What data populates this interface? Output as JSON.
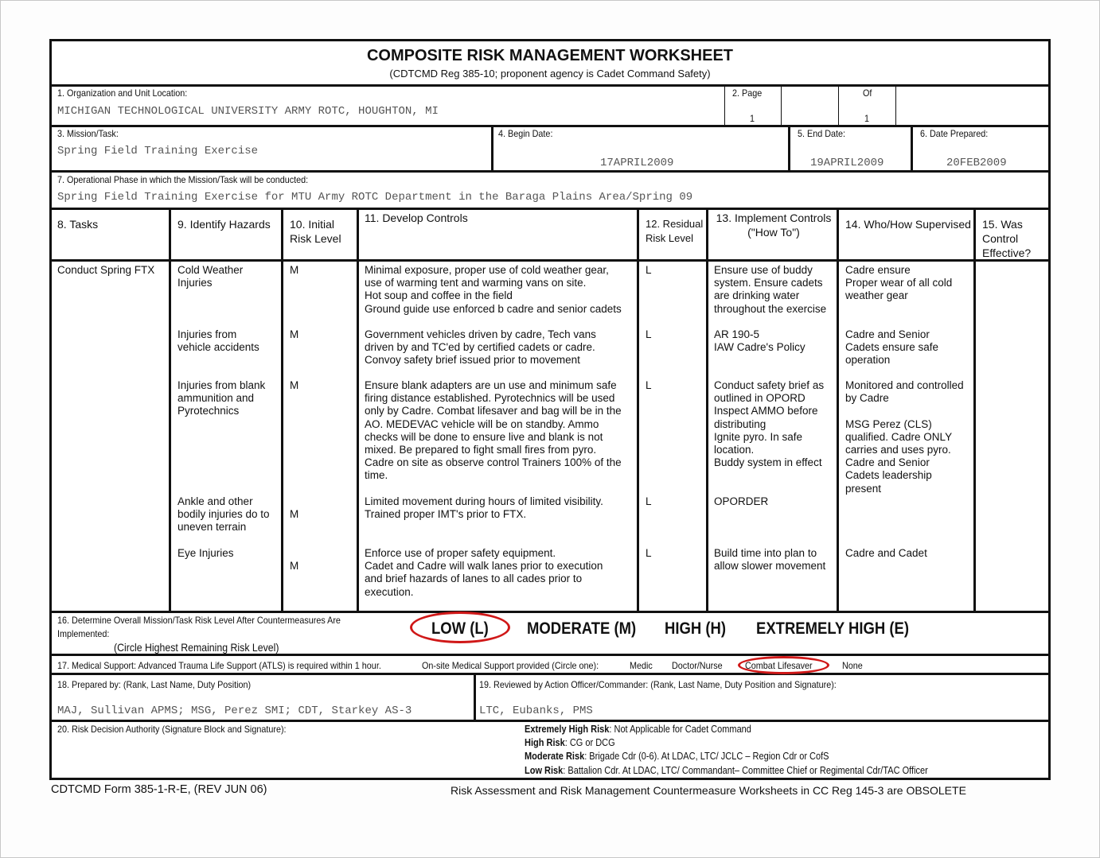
{
  "header": {
    "title": "COMPOSITE RISK MANAGEMENT WORKSHEET",
    "subtitle": "(CDTCMD Reg 385-10; proponent agency is Cadet Command Safety)"
  },
  "block1": {
    "label": "1.  Organization and Unit Location:",
    "value": "MICHIGAN TECHNOLOGICAL UNIVERSITY ARMY ROTC, HOUGHTON, MI"
  },
  "block2": {
    "label": "2.  Page",
    "page": "1",
    "of_label": "Of",
    "of_value": "1"
  },
  "block3": {
    "label": "3.  Mission/Task:",
    "value": "Spring Field Training Exercise"
  },
  "block4": {
    "label": "4. Begin Date:",
    "value": "17APRIL2009"
  },
  "block5": {
    "label": "5.  End Date:",
    "value": "19APRIL2009"
  },
  "block6": {
    "label": "6.  Date Prepared:",
    "value": "20FEB2009"
  },
  "block7": {
    "label": "7.  Operational Phase in which the Mission/Task will be conducted:",
    "value": "Spring Field Training Exercise for MTU Army ROTC Department in the Baraga Plains Area/Spring 09"
  },
  "table": {
    "headers": [
      "8. Tasks",
      "9.  Identify Hazards",
      "10. Initial\nRisk Level",
      "11.  Develop Controls",
      "12. Residual\nRisk Level",
      "13. Implement Controls\n(\"How To\")",
      "14. Who/How Supervised",
      "15. Was\nControl\nEffective?"
    ],
    "task": "Conduct Spring FTX",
    "rows": [
      {
        "hazard": "Cold Weather\nInjuries",
        "initial": "M",
        "controls": "Minimal exposure, proper use of cold weather gear,\nuse of warming tent and warming vans on site.\nHot soup and coffee in the field\nGround guide use enforced b cadre and senior cadets",
        "residual": "L",
        "implement": "Ensure use of buddy\nsystem. Ensure cadets\nare drinking water\nthroughout the exercise",
        "supervised": "Cadre ensure\nProper wear of all cold\nweather gear",
        "effective": ""
      },
      {
        "hazard": "Injuries from\nvehicle accidents",
        "initial": "M",
        "controls": "Government vehicles driven by cadre, Tech vans\ndriven by and TC'ed by certified cadets or cadre.\nConvoy safety brief issued prior to movement",
        "residual": "L",
        "implement": "AR 190-5\nIAW Cadre's Policy",
        "supervised": "Cadre and Senior\nCadets ensure safe\noperation",
        "effective": ""
      },
      {
        "hazard": "Injuries from blank\nammunition and\nPyrotechnics",
        "initial": "M",
        "controls": "Ensure blank adapters are un use and minimum safe\nfiring distance established. Pyrotechnics will be used\nonly by Cadre. Combat lifesaver and bag will be in the\nAO. MEDEVAC vehicle will be on standby. Ammo\nchecks will be done to ensure live and blank is not\nmixed. Be prepared to fight small fires from pyro.\nCadre on site as observe control Trainers 100% of the\ntime.",
        "residual": "L",
        "implement": "Conduct safety brief as\noutlined in OPORD\nInspect AMMO before\ndistributing\nIgnite pyro. In safe\nlocation.\nBuddy system in effect",
        "supervised": "Monitored and controlled\nby Cadre\n\nMSG Perez (CLS)\nqualified. Cadre ONLY\ncarries and uses pyro.\nCadre and Senior\nCadets leadership\npresent",
        "effective": ""
      },
      {
        "hazard": "Ankle and other\nbodily injuries do to\nuneven terrain",
        "initial": "M",
        "controls": "Limited movement during hours of limited visibility.\nTrained proper IMT's prior to FTX.",
        "residual": "L",
        "implement": "OPORDER",
        "supervised": "",
        "effective": ""
      },
      {
        "hazard": "Eye Injuries",
        "initial": "M",
        "controls": "Enforce use of proper safety equipment.\nCadet and Cadre will walk lanes prior to execution\nand brief hazards of lanes to all cades prior to\nexecution.",
        "residual": "L",
        "implement": "Build time into plan to\nallow slower movement",
        "supervised": "Cadre and Cadet",
        "effective": ""
      }
    ]
  },
  "block16": {
    "label_line1": "16.  Determine Overall Mission/Task Risk Level After Countermeasures Are",
    "label_line2": "Implemented:",
    "instruction": "(Circle Highest Remaining Risk Level)",
    "options": [
      "LOW (L)",
      "MODERATE (M)",
      "HIGH (H)",
      "EXTREMELY HIGH (E)"
    ],
    "selected": "LOW (L)",
    "circle_color": "#d01818"
  },
  "block17": {
    "label": "17.  Medical Support:  Advanced Trauma Life Support (ATLS) is required within 1 hour.",
    "onsite_label": "On-site Medical Support provided (Circle one):",
    "options": [
      "Medic",
      "Doctor/Nurse",
      "Combat Lifesaver",
      "None"
    ],
    "selected": "Combat Lifesaver"
  },
  "block18": {
    "label": "18.  Prepared by: (Rank, Last Name, Duty Position)",
    "value": "MAJ, Sullivan APMS; MSG, Perez SMI; CDT, Starkey AS-3"
  },
  "block19": {
    "label": "19.  Reviewed by Action Officer/Commander: (Rank, Last Name, Duty Position and Signature):",
    "value": "LTC, Eubanks, PMS"
  },
  "block20": {
    "label": "20.  Risk Decision Authority (Signature Block and Signature):",
    "authorities": [
      {
        "level": "Extremely High Risk",
        "text": ":  Not Applicable for Cadet Command"
      },
      {
        "level": "High Risk",
        "text": ":  CG or DCG"
      },
      {
        "level": "Moderate Risk",
        "text": ": Brigade Cdr (0-6).  At LDAC, LTC/ JCLC – Region Cdr or CofS"
      },
      {
        "level": "Low Risk",
        "text": ":  Battalion Cdr.  At LDAC, LTC/ Commandant– Committee Chief or Regimental Cdr/TAC Officer"
      }
    ]
  },
  "footer": {
    "form_id": "CDTCMD Form 385-1-R-E, (REV JUN 06)",
    "obsolete_note": "Risk Assessment and Risk Management Countermeasure Worksheets in CC Reg 145-3 are OBSOLETE"
  }
}
